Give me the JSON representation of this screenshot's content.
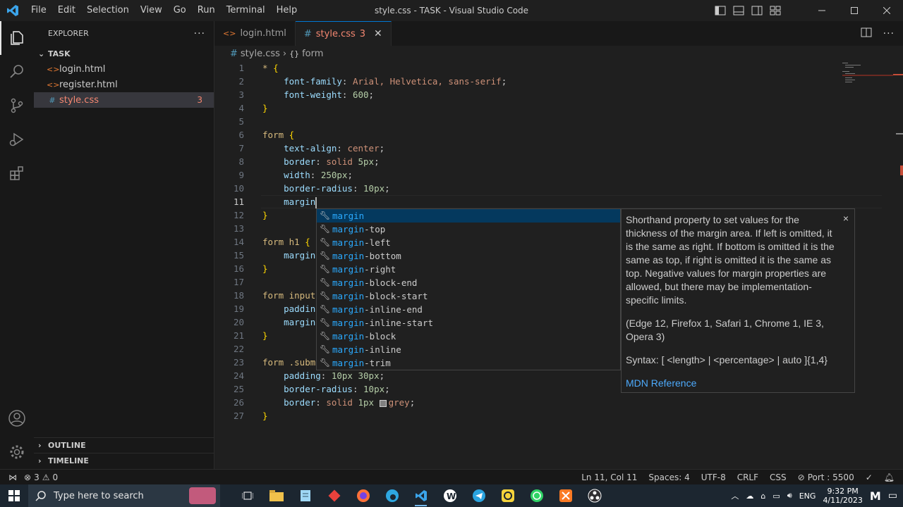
{
  "window": {
    "title": "style.css - TASK - Visual Studio Code",
    "menu": [
      "File",
      "Edit",
      "Selection",
      "View",
      "Go",
      "Run",
      "Terminal",
      "Help"
    ]
  },
  "sidebar": {
    "header": "EXPLORER",
    "more": "···",
    "folder": "TASK",
    "files": [
      {
        "name": "login.html",
        "icon": "<>"
      },
      {
        "name": "register.html",
        "icon": "<>"
      },
      {
        "name": "style.css",
        "icon": "#",
        "badge": "3"
      }
    ],
    "outline": "OUTLINE",
    "timeline": "TIMELINE"
  },
  "tabs": [
    {
      "label": "login.html",
      "icon": "<>"
    },
    {
      "label": "style.css",
      "icon": "#",
      "badge": "3",
      "close": "✕"
    }
  ],
  "breadcrumb": {
    "file": "style.css",
    "symbol": "form",
    "sep": "›"
  },
  "editor": {
    "current_line": 11,
    "lines": [
      {
        "n": "1",
        "t": [
          [
            "* ",
            "sel-k"
          ],
          [
            "{",
            "brace"
          ]
        ]
      },
      {
        "n": "2",
        "t": [
          [
            "    "
          ],
          [
            "font-family",
            "prop"
          ],
          [
            ": "
          ],
          [
            "Arial, Helvetica, sans-serif",
            "val"
          ],
          [
            ";"
          ]
        ]
      },
      {
        "n": "3",
        "t": [
          [
            "    "
          ],
          [
            "font-weight",
            "prop"
          ],
          [
            ": "
          ],
          [
            "600",
            "num"
          ],
          [
            ";"
          ]
        ]
      },
      {
        "n": "4",
        "t": [
          [
            "}",
            "brace"
          ]
        ]
      },
      {
        "n": "5",
        "t": []
      },
      {
        "n": "6",
        "t": [
          [
            "form ",
            "sel-k"
          ],
          [
            "{",
            "brace"
          ]
        ]
      },
      {
        "n": "7",
        "t": [
          [
            "    "
          ],
          [
            "text-align",
            "prop"
          ],
          [
            ": "
          ],
          [
            "center",
            "val"
          ],
          [
            ";"
          ]
        ]
      },
      {
        "n": "8",
        "t": [
          [
            "    "
          ],
          [
            "border",
            "prop"
          ],
          [
            ": "
          ],
          [
            "solid ",
            "val"
          ],
          [
            "5px",
            "num"
          ],
          [
            ";"
          ]
        ]
      },
      {
        "n": "9",
        "t": [
          [
            "    "
          ],
          [
            "width",
            "prop"
          ],
          [
            ": "
          ],
          [
            "250px",
            "num"
          ],
          [
            ";"
          ]
        ]
      },
      {
        "n": "10",
        "t": [
          [
            "    "
          ],
          [
            "border-radius",
            "prop"
          ],
          [
            ": "
          ],
          [
            "10px",
            "num"
          ],
          [
            ";"
          ]
        ]
      },
      {
        "n": "11",
        "t": [
          [
            "    "
          ],
          [
            "margin",
            "prop"
          ]
        ]
      },
      {
        "n": "12",
        "t": [
          [
            "}",
            "brace"
          ]
        ]
      },
      {
        "n": "13",
        "t": []
      },
      {
        "n": "14",
        "t": [
          [
            "form h1 ",
            "sel-k"
          ],
          [
            "{",
            "brace"
          ]
        ]
      },
      {
        "n": "15",
        "t": [
          [
            "    "
          ],
          [
            "margin",
            "prop"
          ]
        ]
      },
      {
        "n": "16",
        "t": [
          [
            "}",
            "brace"
          ]
        ]
      },
      {
        "n": "17",
        "t": []
      },
      {
        "n": "18",
        "t": [
          [
            "form input",
            "sel-k"
          ]
        ]
      },
      {
        "n": "19",
        "t": [
          [
            "    "
          ],
          [
            "paddin",
            "prop"
          ]
        ]
      },
      {
        "n": "20",
        "t": [
          [
            "    "
          ],
          [
            "margin",
            "prop"
          ]
        ]
      },
      {
        "n": "21",
        "t": [
          [
            "}",
            "brace"
          ]
        ]
      },
      {
        "n": "22",
        "t": []
      },
      {
        "n": "23",
        "t": [
          [
            "form .subm",
            "sel-k"
          ]
        ]
      },
      {
        "n": "24",
        "t": [
          [
            "    "
          ],
          [
            "padding",
            "prop"
          ],
          [
            ": "
          ],
          [
            "10px 30px",
            "num"
          ],
          [
            ";"
          ]
        ]
      },
      {
        "n": "25",
        "t": [
          [
            "    "
          ],
          [
            "border-radius",
            "prop"
          ],
          [
            ": "
          ],
          [
            "10px",
            "num"
          ],
          [
            ";"
          ]
        ]
      },
      {
        "n": "26",
        "t": [
          [
            "    "
          ],
          [
            "border",
            "prop"
          ],
          [
            ": "
          ],
          [
            "solid ",
            "val"
          ],
          [
            "1px ",
            "num"
          ],
          [
            "■",
            "swatch"
          ],
          [
            "grey",
            "val"
          ],
          [
            ";"
          ]
        ]
      },
      {
        "n": "27",
        "t": [
          [
            "}",
            "brace"
          ]
        ]
      }
    ]
  },
  "suggest": {
    "prefix": "margin",
    "items": [
      "margin",
      "margin-top",
      "margin-left",
      "margin-bottom",
      "margin-right",
      "margin-block-end",
      "margin-block-start",
      "margin-inline-end",
      "margin-inline-start",
      "margin-block",
      "margin-inline",
      "margin-trim"
    ],
    "selected_index": 0
  },
  "doc": {
    "close": "×",
    "description": "Shorthand property to set values for the thickness of the margin area. If left is omitted, it is the same as right. If bottom is omitted it is the same as top, if right is omitted it is the same as top. Negative values for margin properties are allowed, but there may be implementation-specific limits.",
    "browsers": "(Edge 12, Firefox 1, Safari 1, Chrome 1, IE 3, Opera 3)",
    "syntax": "Syntax: [ <length> | <percentage> | auto ]{1,4}",
    "link": "MDN Reference"
  },
  "status": {
    "errors": "3",
    "warnings": "0",
    "position": "Ln 11, Col 11",
    "spaces": "Spaces: 4",
    "encoding": "UTF-8",
    "eol": "CRLF",
    "language": "CSS",
    "port": "Port : 5500"
  },
  "taskbar": {
    "search_placeholder": "Type here to search",
    "lang": "ENG",
    "time": "9:32 PM",
    "date": "4/11/2023"
  },
  "colors": {
    "accent": "#0078d4",
    "error": "#f48771",
    "brace": "#ffd700"
  }
}
